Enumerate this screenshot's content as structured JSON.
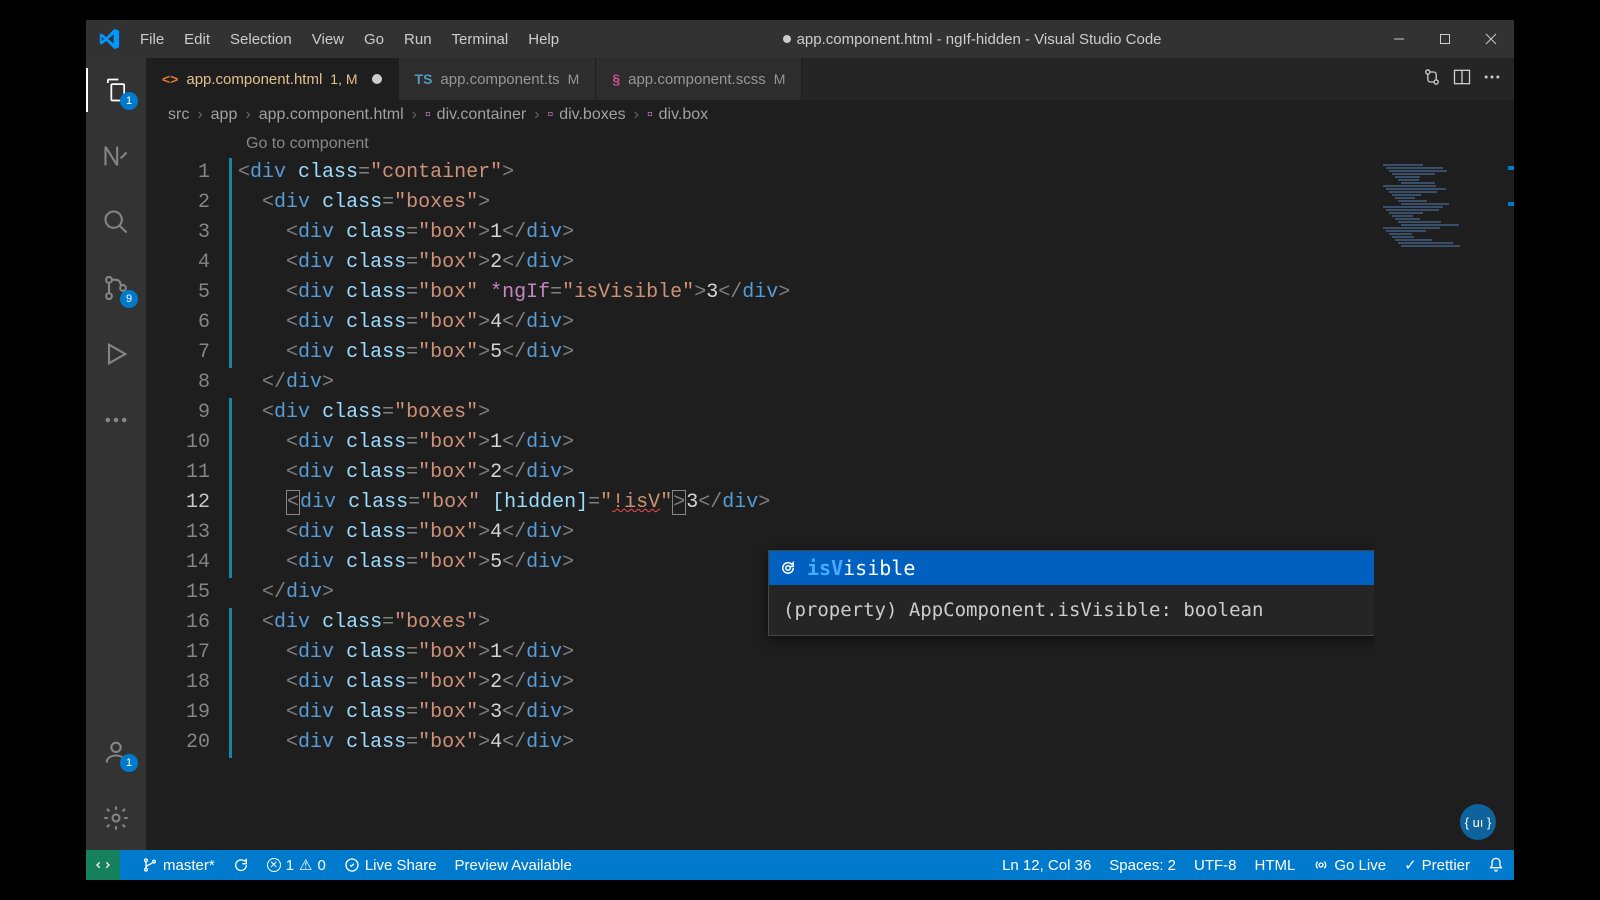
{
  "window": {
    "title": "app.component.html - ngIf-hidden - Visual Studio Code",
    "modified_indicator": true
  },
  "menu": [
    "File",
    "Edit",
    "Selection",
    "View",
    "Go",
    "Run",
    "Terminal",
    "Help"
  ],
  "activity": {
    "explorer_badge": "1",
    "scm_badge": "9",
    "accounts_badge": "1"
  },
  "tabs": [
    {
      "icon": "html",
      "label": "app.component.html",
      "status": "1, M",
      "active": true,
      "dirty": true
    },
    {
      "icon": "ts",
      "label": "app.component.ts",
      "status": "M",
      "active": false,
      "dirty": false
    },
    {
      "icon": "scss",
      "label": "app.component.scss",
      "status": "M",
      "active": false,
      "dirty": false
    }
  ],
  "breadcrumbs": [
    "src",
    "app",
    "app.component.html",
    "div.container",
    "div.boxes",
    "div.box"
  ],
  "codelens": "Go to component",
  "code": {
    "lines": [
      {
        "n": 1,
        "indent": 0,
        "kind": "open",
        "cls": "container"
      },
      {
        "n": 2,
        "indent": 1,
        "kind": "open",
        "cls": "boxes"
      },
      {
        "n": 3,
        "indent": 2,
        "kind": "box",
        "text": "1"
      },
      {
        "n": 4,
        "indent": 2,
        "kind": "box",
        "text": "2"
      },
      {
        "n": 5,
        "indent": 2,
        "kind": "box_ngif",
        "expr": "isVisible",
        "text": "3"
      },
      {
        "n": 6,
        "indent": 2,
        "kind": "box",
        "text": "4"
      },
      {
        "n": 7,
        "indent": 2,
        "kind": "box",
        "text": "5"
      },
      {
        "n": 8,
        "indent": 1,
        "kind": "close"
      },
      {
        "n": 9,
        "indent": 1,
        "kind": "open",
        "cls": "boxes"
      },
      {
        "n": 10,
        "indent": 2,
        "kind": "box",
        "text": "1"
      },
      {
        "n": 11,
        "indent": 2,
        "kind": "box",
        "text": "2"
      },
      {
        "n": 12,
        "indent": 2,
        "kind": "box_hidden",
        "expr": "!isV",
        "text": "3",
        "cursor": true
      },
      {
        "n": 13,
        "indent": 2,
        "kind": "box",
        "text": "4"
      },
      {
        "n": 14,
        "indent": 2,
        "kind": "box",
        "text": "5"
      },
      {
        "n": 15,
        "indent": 1,
        "kind": "close"
      },
      {
        "n": 16,
        "indent": 1,
        "kind": "open",
        "cls": "boxes"
      },
      {
        "n": 17,
        "indent": 2,
        "kind": "box",
        "text": "1"
      },
      {
        "n": 18,
        "indent": 2,
        "kind": "box",
        "text": "2"
      },
      {
        "n": 19,
        "indent": 2,
        "kind": "box",
        "text": "3"
      },
      {
        "n": 20,
        "indent": 2,
        "kind": "box",
        "text": "4"
      }
    ],
    "current_line": 12
  },
  "suggest": {
    "item_prefix": "isV",
    "item_suffix": "isible",
    "detail": "(property) AppComponent.isVisible: boolean"
  },
  "status": {
    "branch": "master*",
    "errors": "1",
    "warnings": "0",
    "live_share": "Live Share",
    "preview": "Preview Available",
    "cursor": "Ln 12, Col 36",
    "spaces": "Spaces: 2",
    "encoding": "UTF-8",
    "language": "HTML",
    "go_live": "Go Live",
    "prettier": "Prettier"
  },
  "icons": {
    "html_color": "#e37933",
    "ts_color": "#519aba",
    "scss_color": "#c6538c"
  }
}
